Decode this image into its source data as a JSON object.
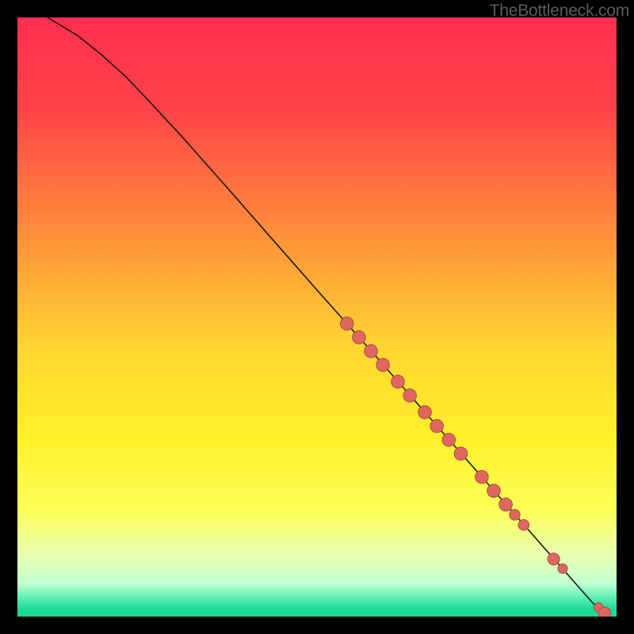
{
  "watermark": "TheBottleneck.com",
  "chart_data": {
    "type": "line",
    "title": "",
    "xlabel": "",
    "ylabel": "",
    "xlim": [
      0,
      100
    ],
    "ylim": [
      0,
      100
    ],
    "background_gradient_stops": [
      {
        "pos": 0.0,
        "color": "#ff2e4e"
      },
      {
        "pos": 0.15,
        "color": "#ff4249"
      },
      {
        "pos": 0.35,
        "color": "#ff8b3a"
      },
      {
        "pos": 0.55,
        "color": "#ffd531"
      },
      {
        "pos": 0.7,
        "color": "#fff02a"
      },
      {
        "pos": 0.82,
        "color": "#fcff55"
      },
      {
        "pos": 0.9,
        "color": "#e7ffb4"
      },
      {
        "pos": 0.945,
        "color": "#c0ffd0"
      },
      {
        "pos": 0.965,
        "color": "#6cf2b8"
      },
      {
        "pos": 0.985,
        "color": "#22dd9a"
      },
      {
        "pos": 1.0,
        "color": "#17d890"
      }
    ],
    "curve": [
      {
        "x": 5.0,
        "y": 100.0
      },
      {
        "x": 7.0,
        "y": 98.8
      },
      {
        "x": 10.0,
        "y": 97.0
      },
      {
        "x": 14.0,
        "y": 93.8
      },
      {
        "x": 18.0,
        "y": 90.2
      },
      {
        "x": 22.0,
        "y": 86.0
      },
      {
        "x": 28.0,
        "y": 79.5
      },
      {
        "x": 35.0,
        "y": 71.6
      },
      {
        "x": 42.0,
        "y": 63.6
      },
      {
        "x": 50.0,
        "y": 54.5
      },
      {
        "x": 58.0,
        "y": 45.5
      },
      {
        "x": 66.0,
        "y": 36.4
      },
      {
        "x": 74.0,
        "y": 27.3
      },
      {
        "x": 82.0,
        "y": 18.2
      },
      {
        "x": 90.0,
        "y": 9.1
      },
      {
        "x": 96.0,
        "y": 2.3
      },
      {
        "x": 98.0,
        "y": 0.6
      }
    ],
    "points": [
      {
        "x": 55.0,
        "y": 48.9,
        "r": 1.1
      },
      {
        "x": 57.0,
        "y": 46.6,
        "r": 1.1
      },
      {
        "x": 59.0,
        "y": 44.3,
        "r": 1.1
      },
      {
        "x": 61.0,
        "y": 42.0,
        "r": 1.1
      },
      {
        "x": 63.5,
        "y": 39.2,
        "r": 1.1
      },
      {
        "x": 65.5,
        "y": 36.9,
        "r": 1.1
      },
      {
        "x": 68.0,
        "y": 34.1,
        "r": 1.1
      },
      {
        "x": 70.0,
        "y": 31.8,
        "r": 1.1
      },
      {
        "x": 72.0,
        "y": 29.5,
        "r": 1.1
      },
      {
        "x": 74.0,
        "y": 27.2,
        "r": 1.1
      },
      {
        "x": 77.5,
        "y": 23.3,
        "r": 1.1
      },
      {
        "x": 79.5,
        "y": 21.0,
        "r": 1.1
      },
      {
        "x": 81.5,
        "y": 18.7,
        "r": 1.1
      },
      {
        "x": 83.0,
        "y": 17.0,
        "r": 0.9
      },
      {
        "x": 84.5,
        "y": 15.3,
        "r": 0.9
      },
      {
        "x": 89.5,
        "y": 9.6,
        "r": 1.0
      },
      {
        "x": 91.0,
        "y": 8.0,
        "r": 0.8
      },
      {
        "x": 97.0,
        "y": 1.5,
        "r": 0.8
      },
      {
        "x": 98.0,
        "y": 0.6,
        "r": 1.0
      }
    ],
    "curve_color": "#1a1a1a",
    "point_color": "#e06760",
    "point_stroke": "#a04a48"
  }
}
